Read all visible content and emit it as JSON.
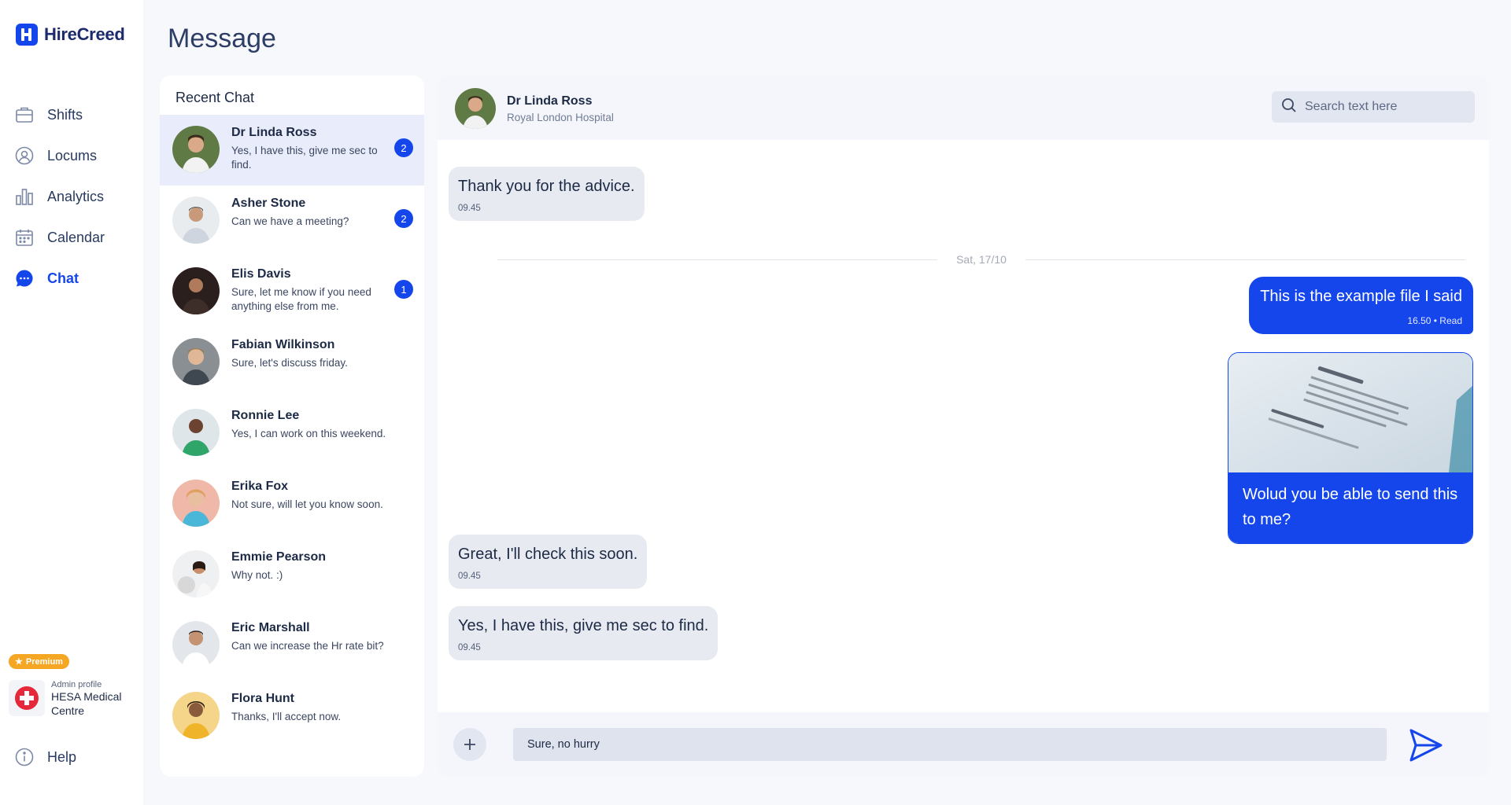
{
  "app": {
    "brand": "HireCreed",
    "page_title": "Message"
  },
  "sidebar": {
    "items": [
      {
        "label": "Shifts",
        "icon": "briefcase-icon"
      },
      {
        "label": "Locums",
        "icon": "user-circle-icon"
      },
      {
        "label": "Analytics",
        "icon": "bar-chart-icon"
      },
      {
        "label": "Calendar",
        "icon": "calendar-icon"
      },
      {
        "label": "Chat",
        "icon": "chat-bubble-icon",
        "active": true
      }
    ],
    "premium_label": "Premium",
    "admin": {
      "caption": "Admin profile",
      "name": "HESA Medical Centre"
    },
    "help_label": "Help"
  },
  "recent": {
    "title": "Recent Chat",
    "chats": [
      {
        "name": "Dr Linda Ross",
        "message": "Yes, I have this, give me sec to find.",
        "unread": "2",
        "active": true
      },
      {
        "name": "Asher Stone",
        "message": "Can we have a meeting?",
        "unread": "2"
      },
      {
        "name": "Elis Davis",
        "message": "Sure, let me know if you need anything else from me.",
        "unread": "1"
      },
      {
        "name": "Fabian Wilkinson",
        "message": "Sure, let's discuss friday.",
        "unread": ""
      },
      {
        "name": "Ronnie Lee",
        "message": "Yes, I can work on this weekend.",
        "unread": ""
      },
      {
        "name": "Erika Fox",
        "message": "Not sure, will let you know soon.",
        "unread": ""
      },
      {
        "name": "Emmie Pearson",
        "message": "Why not. :)",
        "unread": ""
      },
      {
        "name": "Eric Marshall",
        "message": "Can we increase the Hr rate bit?",
        "unread": ""
      },
      {
        "name": "Flora Hunt",
        "message": "Thanks,  I'll accept now.",
        "unread": ""
      }
    ]
  },
  "conversation": {
    "contact_name": "Dr Linda Ross",
    "contact_org": "Royal London Hospital",
    "search_placeholder": "Search text here",
    "messages": {
      "m1": {
        "text": "Thank you for the advice.",
        "time": "09.45"
      },
      "date_separator": "Sat, 17/10",
      "m2": {
        "text": "This is the example file I said",
        "time": "16.50 • Read"
      },
      "m3": {
        "caption": "Wolud you be able to send this to me?"
      },
      "m4": {
        "text": "Great, I'll check this soon.",
        "time": "09.45"
      },
      "m5": {
        "text": "Yes, I have this, give me sec to find.",
        "time": "09.45"
      }
    },
    "composer_value": "Sure, no hurry"
  },
  "colors": {
    "accent": "#1546ec",
    "premium": "#f5a623",
    "incoming_bubble": "#e7eaf1"
  }
}
